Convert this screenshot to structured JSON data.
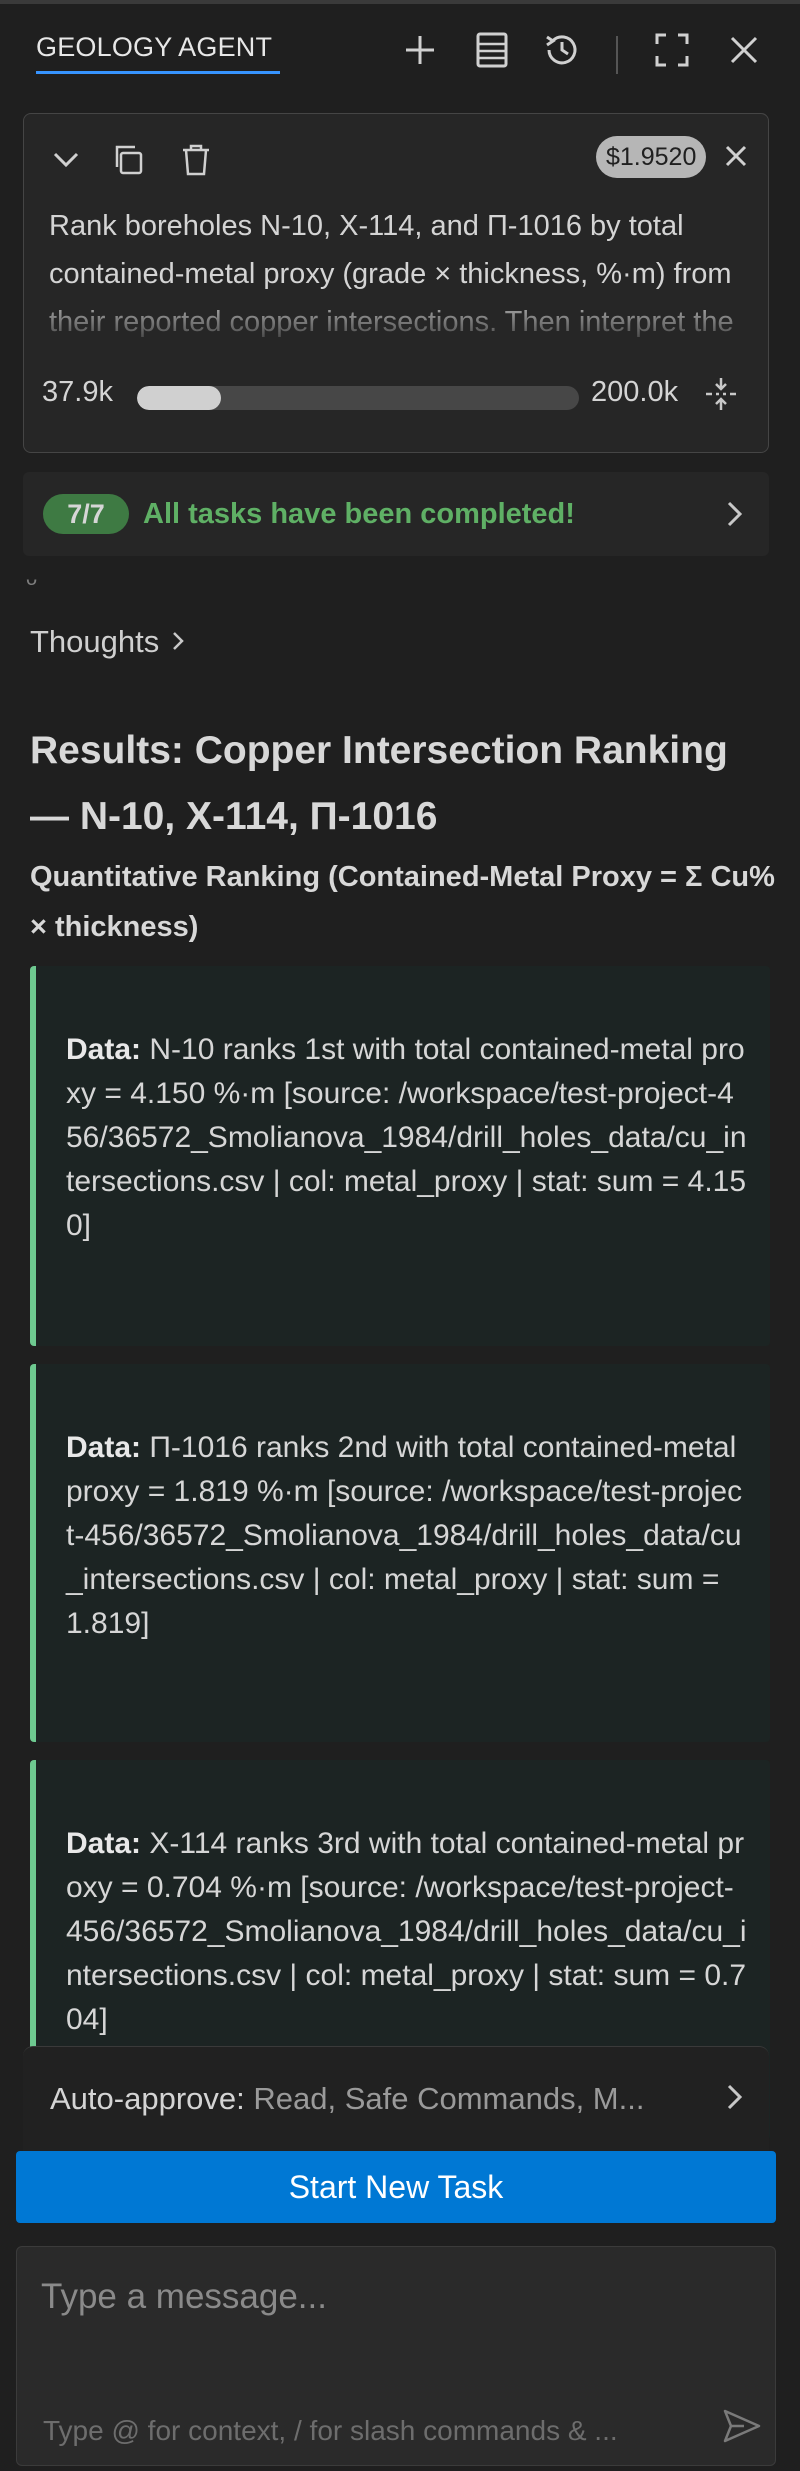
{
  "header": {
    "tab_label": "GEOLOGY AGENT",
    "icons": [
      "plus-icon",
      "history-list-icon",
      "history-clock-icon",
      "fullscreen-icon",
      "close-icon"
    ]
  },
  "task": {
    "cost": "$1.9520",
    "text": "Rank boreholes N-10, X-114, and П-1016 by total contained-metal proxy (grade × thickness, %·m) from their reported copper intersections. Then interpret the ranking.",
    "context_used": "37.9k",
    "context_total": "200.0k",
    "context_fraction": 0.19
  },
  "progress": {
    "count": "7/7",
    "message": "All tasks have been completed!"
  },
  "stray_mark": "ᴗ",
  "thoughts_label": "Thoughts",
  "results": {
    "title": "Results: Copper Intersection Ranking — N-10, X-114, П-1016",
    "subtitle": "Quantitative Ranking (Contained-Metal Proxy = Σ Cu% × thickness)",
    "blocks": [
      {
        "label": "Data:",
        "text": "N-10 ranks 1st with total contained-metal proxy = 4.150 %·m [source: /workspace/test-project-456/36572_Smolianova_1984/drill_holes_data/cu_intersections.csv | col: metal_proxy | stat: sum = 4.150]"
      },
      {
        "label": "Data:",
        "text": "П-1016 ranks 2nd with total contained-metal proxy = 1.819 %·m [source: /workspace/test-project-456/36572_Smolianova_1984/drill_holes_data/cu_intersections.csv | col: metal_proxy | stat: sum = 1.819]"
      },
      {
        "label": "Data:",
        "text": "X-114 ranks 3rd with total contained-metal proxy = 0.704 %·m [source: /workspace/test-project-456/36572_Smolianova_1984/drill_holes_data/cu_intersections.csv | col: metal_proxy | stat: sum = 0.704]"
      }
    ]
  },
  "auto_approve": {
    "label": "Auto-approve:",
    "values": "Read, Safe Commands, M..."
  },
  "start_button": "Start New Task",
  "composer": {
    "placeholder": "Type a message...",
    "hint": "Type @ for context, / for slash commands & ..."
  },
  "colors": {
    "accent_blue": "#0078d4",
    "success_green": "#5fb065",
    "badge_green": "#3e7a43",
    "block_border": "#6ec990"
  }
}
